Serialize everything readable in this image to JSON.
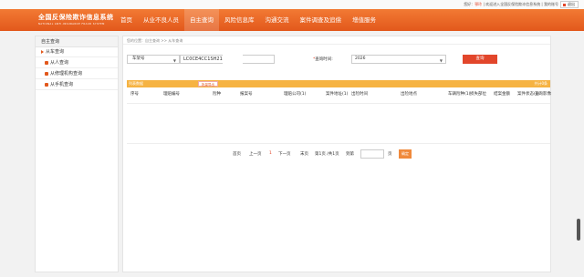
{
  "topbar": {
    "greeting": "您好：",
    "user_name": "鄂玲",
    "welcome_text": "| 欢迎进入全国反保险欺诈信息系统 |",
    "my_account": "我的账号",
    "mail_label": "退出"
  },
  "header": {
    "logo_cn": "全国反保险欺诈信息系统",
    "logo_en": "NATIONAL ANTI-INSURANCE FRAUD SYSTEM"
  },
  "nav": {
    "items": [
      {
        "label": "首页"
      },
      {
        "label": "从业不良人员"
      },
      {
        "label": "自主查询"
      },
      {
        "label": "风险信息库"
      },
      {
        "label": "沟通交流"
      },
      {
        "label": "案件调查及追偿"
      },
      {
        "label": "增值服务"
      }
    ]
  },
  "sidebar": {
    "title": "自主查询",
    "sub_title": "从车查询",
    "items": [
      {
        "label": "从人查询"
      },
      {
        "label": "从修理机构查询"
      },
      {
        "label": "从手机查询"
      }
    ]
  },
  "breadcrumb": "您的位置：自主查询 >> 从车查询",
  "search": {
    "type_value": "车架号",
    "vin_value": "LC0CE4CC1SH2159",
    "time_label": "查询时间:",
    "time_required_mark": "*",
    "year_value": "2026",
    "query_button": "查询"
  },
  "result_bar": {
    "left_text": "列表数据",
    "export_label": "批量导出",
    "right_text": "共计0条"
  },
  "table": {
    "headers": [
      "序号",
      "理赔编号",
      "险种",
      "报案号",
      "理赔公司(1)",
      "案件地址(1)",
      "出险时间",
      "出险地点",
      "车辆险种(1)",
      "损失部位",
      "结案金额",
      "案件状态(1)",
      "查询影像"
    ]
  },
  "pagination": {
    "first": "首页",
    "prev": "上一页",
    "current": "1",
    "next": "下一页",
    "last": "末页",
    "info": "第1页 /共1页",
    "goto_label": "到第",
    "page_unit": "页",
    "go_button": "确定"
  }
}
